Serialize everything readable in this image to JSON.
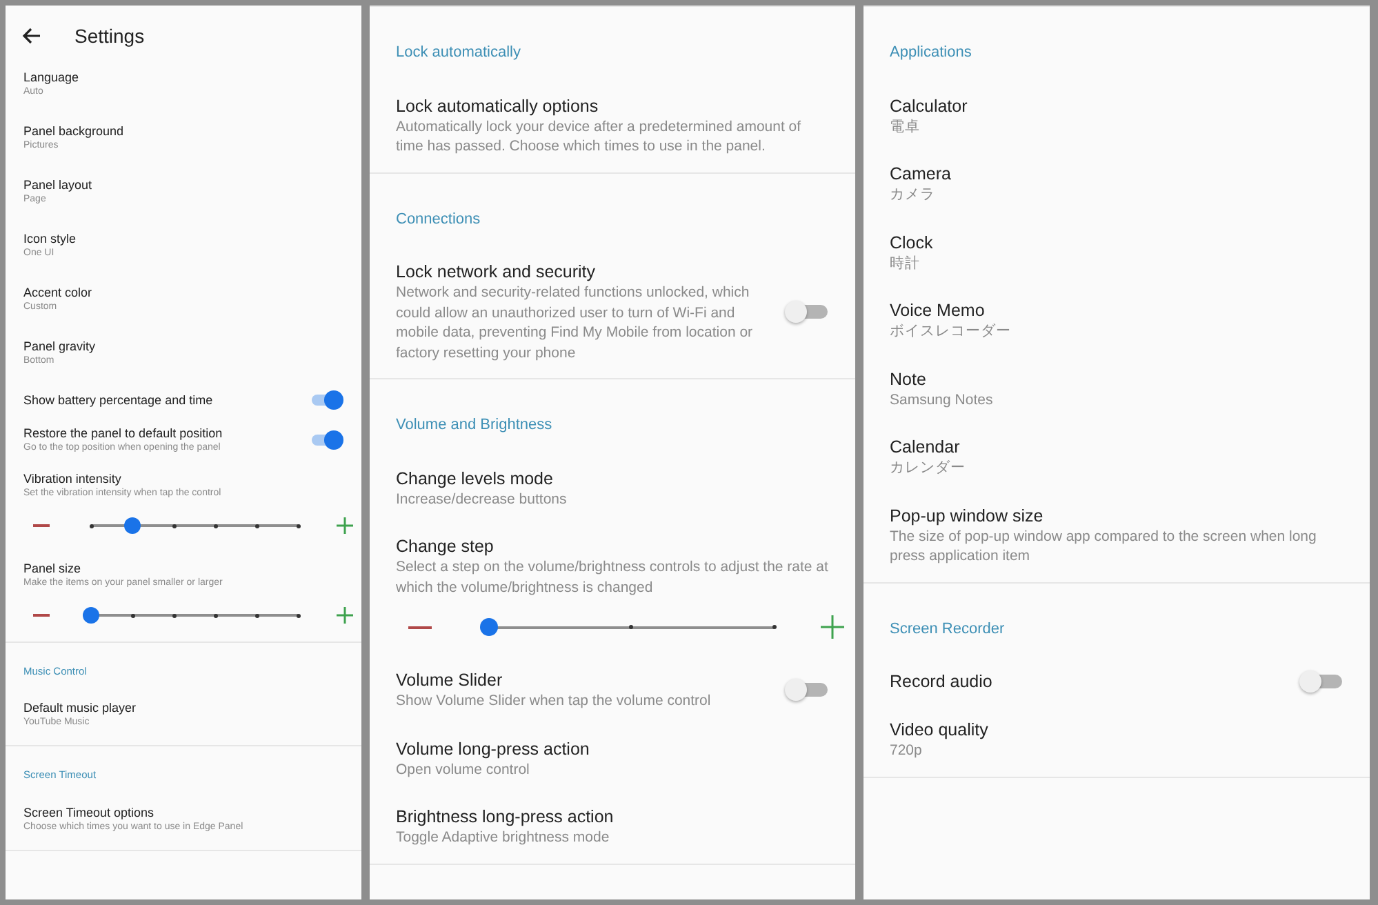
{
  "panels": [
    {
      "header": {
        "title": "Settings"
      },
      "sections": [
        {
          "items": [
            {
              "kind": "text",
              "title": "Language",
              "subtitle": "Auto"
            },
            {
              "kind": "text",
              "title": "Panel background",
              "subtitle": "Pictures"
            },
            {
              "kind": "text",
              "title": "Panel layout",
              "subtitle": "Page"
            },
            {
              "kind": "text",
              "title": "Icon style",
              "subtitle": "One UI"
            },
            {
              "kind": "text",
              "title": "Accent color",
              "subtitle": "Custom"
            },
            {
              "kind": "text",
              "title": "Panel gravity",
              "subtitle": "Bottom"
            },
            {
              "kind": "toggle",
              "title": "Show battery percentage and time",
              "on": true
            },
            {
              "kind": "toggle",
              "title": "Restore the panel to default position",
              "subtitle": "Go to the top position when opening the panel",
              "on": true
            },
            {
              "kind": "slider",
              "title": "Vibration intensity",
              "subtitle": "Set the vibration intensity when tap the control",
              "level": 0.2
            },
            {
              "kind": "slider",
              "title": "Panel size",
              "subtitle": "Make the items on your panel smaller or larger",
              "level": 0
            }
          ]
        },
        {
          "title": "Music Control",
          "items": [
            {
              "kind": "text",
              "title": "Default music player",
              "subtitle": "YouTube Music"
            }
          ]
        },
        {
          "title": "Screen Timeout",
          "items": [
            {
              "kind": "text",
              "title": "Screen Timeout options",
              "subtitle": "Choose which times you want to use in Edge Panel"
            }
          ]
        }
      ]
    },
    {
      "sections": [
        {
          "title": "Lock automatically",
          "items": [
            {
              "kind": "text",
              "title": "Lock automatically options",
              "subtitle": "Automatically lock your device after a predetermined amount of time has passed. Choose which times to use in the panel."
            }
          ]
        },
        {
          "title": "Connections",
          "items": [
            {
              "kind": "toggle",
              "title": "Lock network and security",
              "subtitle": "Network and security-related functions unlocked, which could allow an unauthorized user to turn of Wi-Fi and mobile data, preventing Find My Mobile from location or factory resetting your phone",
              "on": false
            }
          ]
        },
        {
          "title": "Volume and Brightness",
          "items": [
            {
              "kind": "text",
              "title": "Change levels mode",
              "subtitle": "Increase/decrease buttons"
            },
            {
              "kind": "slider",
              "title": "Change step",
              "subtitle": "Select a step on the volume/brightness controls to adjust the rate at which the volume/brightness is changed",
              "level": 0
            },
            {
              "kind": "toggle",
              "title": "Volume Slider",
              "subtitle": "Show Volume Slider when tap the volume control",
              "on": false
            },
            {
              "kind": "text",
              "title": "Volume long-press action",
              "subtitle": "Open volume control"
            },
            {
              "kind": "text",
              "title": "Brightness long-press action",
              "subtitle": "Toggle Adaptive brightness mode"
            }
          ]
        }
      ]
    },
    {
      "sections": [
        {
          "title": "Applications",
          "items": [
            {
              "kind": "text",
              "title": "Calculator",
              "subtitle": "電卓"
            },
            {
              "kind": "text",
              "title": "Camera",
              "subtitle": "カメラ"
            },
            {
              "kind": "text",
              "title": "Clock",
              "subtitle": "時計"
            },
            {
              "kind": "text",
              "title": "Voice Memo",
              "subtitle": "ボイスレコーダー"
            },
            {
              "kind": "text",
              "title": "Note",
              "subtitle": "Samsung Notes"
            },
            {
              "kind": "text",
              "title": "Calendar",
              "subtitle": "カレンダー"
            },
            {
              "kind": "text",
              "title": "Pop-up window size",
              "subtitle": "The size of pop-up window app compared to the screen when long press application item"
            }
          ]
        },
        {
          "title": "Screen Recorder",
          "items": [
            {
              "kind": "toggle",
              "title": "Record audio",
              "on": false
            },
            {
              "kind": "text",
              "title": "Video quality",
              "subtitle": "720p"
            }
          ]
        }
      ]
    }
  ]
}
